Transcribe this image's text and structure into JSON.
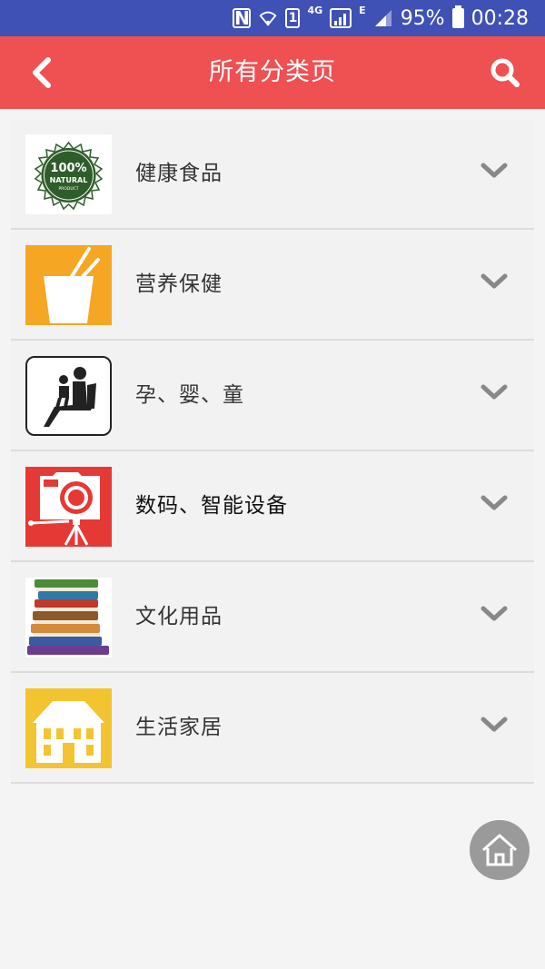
{
  "status_bar": {
    "nfc_label": "N",
    "sim_label": "1",
    "network_4g": "4G",
    "network_e": "E",
    "battery_percent": "95%",
    "time": "00:28"
  },
  "header": {
    "title": "所有分类页",
    "back_icon": "chevron-left-icon",
    "search_icon": "search-icon"
  },
  "categories": [
    {
      "label": "健康食品",
      "icon": "natural-product-badge",
      "badge_text": "100%",
      "badge_sub": "NATURAL",
      "badge_sub2": "PRODUCT",
      "expanded": false
    },
    {
      "label": "营养保健",
      "icon": "drink-cup-icon",
      "expanded": false
    },
    {
      "label": "孕、婴、童",
      "icon": "parent-child-seat-icon",
      "expanded": false
    },
    {
      "label": "数码、智能设备",
      "icon": "camera-tripod-icon",
      "expanded": false
    },
    {
      "label": "文化用品",
      "icon": "book-stack-icon",
      "expanded": false
    },
    {
      "label": "生活家居",
      "icon": "house-icon",
      "expanded": false
    }
  ],
  "fab": {
    "icon": "home-icon"
  },
  "colors": {
    "status_bar": "#3f51b5",
    "header": "#ef5052",
    "background": "#f4f4f4",
    "chevron": "#888888",
    "fab": "#9a9a9a"
  }
}
